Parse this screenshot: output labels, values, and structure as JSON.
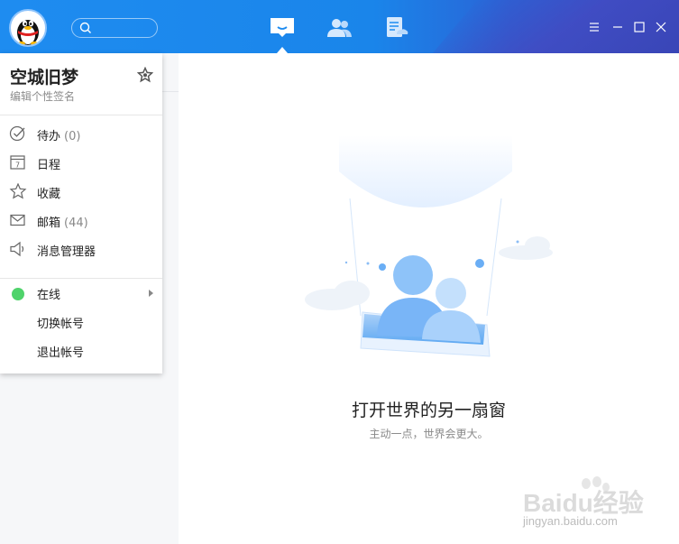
{
  "nav": {
    "tabs": [
      {
        "icon": "chat-icon",
        "active": true
      },
      {
        "icon": "contacts-icon",
        "active": false
      },
      {
        "icon": "space-icon",
        "active": false
      }
    ]
  },
  "window": {
    "controls": [
      "menu-icon",
      "minimize-icon",
      "maximize-icon",
      "close-icon"
    ]
  },
  "profile": {
    "name": "空城旧梦",
    "signature": "编辑个性签名"
  },
  "menu": {
    "todo": {
      "label": "待办",
      "count": "(0)"
    },
    "calendar": {
      "label": "日程",
      "icon_text": "7"
    },
    "favorites": {
      "label": "收藏"
    },
    "mail": {
      "label": "邮箱",
      "count": "(44)"
    },
    "message_manager": {
      "label": "消息管理器"
    },
    "status": {
      "label": "在线",
      "color": "#4fd36b"
    },
    "switch_account": {
      "label": "切换帐号"
    },
    "logout": {
      "label": "退出帐号"
    }
  },
  "main": {
    "title": "打开世界的另一扇窗",
    "subtitle": "主动一点，世界会更大。"
  },
  "watermark": {
    "text": "Baidu经验",
    "url": "jingyan.baidu.com"
  },
  "colors": {
    "accent": "#1e8cf0",
    "online": "#4fd36b"
  }
}
